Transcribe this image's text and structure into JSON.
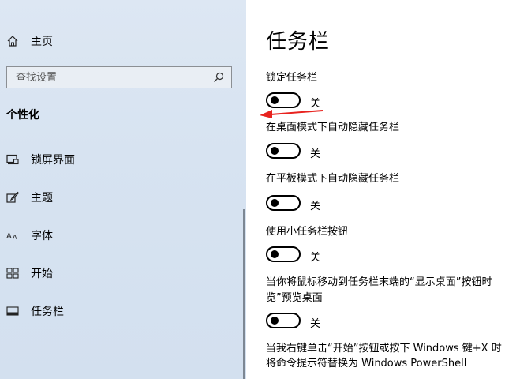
{
  "sidebar": {
    "home_label": "主页",
    "search_placeholder": "查找设置",
    "section_title": "个性化",
    "items": [
      {
        "label": "锁屏界面",
        "icon": "lock-screen-icon"
      },
      {
        "label": "主题",
        "icon": "theme-brush-icon"
      },
      {
        "label": "字体",
        "icon": "font-icon"
      },
      {
        "label": "开始",
        "icon": "start-menu-icon"
      },
      {
        "label": "任务栏",
        "icon": "taskbar-icon"
      }
    ]
  },
  "main": {
    "title": "任务栏",
    "settings": [
      {
        "label": "锁定任务栏",
        "state": "关"
      },
      {
        "label": "在桌面模式下自动隐藏任务栏",
        "state": "关"
      },
      {
        "label": "在平板模式下自动隐藏任务栏",
        "state": "关"
      },
      {
        "label": "使用小任务栏按钮",
        "state": "关"
      },
      {
        "label_line1": "当你将鼠标移动到任务栏末端的“显示桌面”按钮时",
        "label_line2": "览”预览桌面",
        "state": "关"
      }
    ],
    "last_setting_line1": "当我右键单击“开始”按钮或按下 Windows 键+X 时",
    "last_setting_line2": "将命令提示符替换为 Windows PowerShell"
  },
  "colors": {
    "sidebar_bg": "#d7e3f1",
    "annotation_arrow": "#e8231f",
    "toggle_off": "#000000"
  }
}
